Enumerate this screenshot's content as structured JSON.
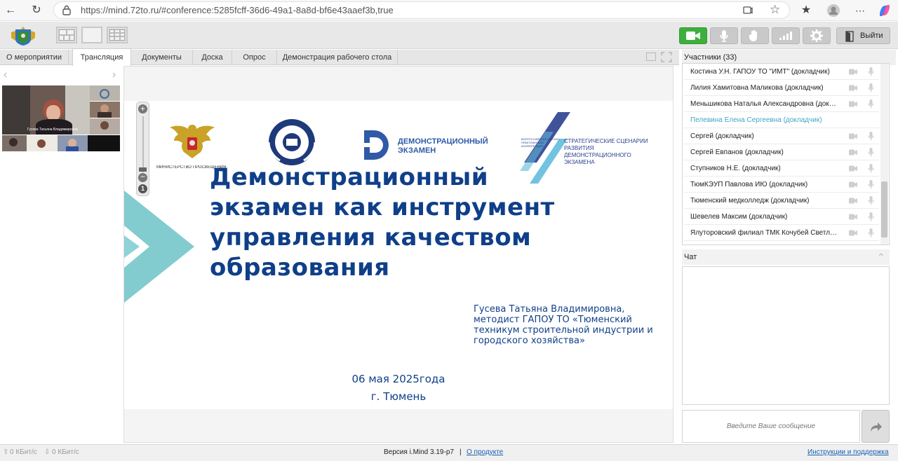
{
  "browser": {
    "url": "https://mind.72to.ru/#conference:5285fcff-36d6-49a1-8a8d-bf6e43aaef3b,true"
  },
  "toolbar": {
    "exit_label": "Выйти"
  },
  "tabs": [
    {
      "label": "О мероприятии"
    },
    {
      "label": "Трансляция"
    },
    {
      "label": "Документы"
    },
    {
      "label": "Доска"
    },
    {
      "label": "Опрос"
    },
    {
      "label": "Демонстрация рабочего стола"
    }
  ],
  "video": {
    "speaker_caption": "Гусева Татьяна Владимировна"
  },
  "slide": {
    "logos": {
      "ministry": "МИНИСТЕРСТВО ПРОСВЕЩЕНИЯ РОССИЙСКОЙ ФЕДЕРАЦИИ",
      "irpo": "ИРПО",
      "demo_exam": "ДЕМОНСТРАЦИОННЫЙ ЭКЗАМЕН",
      "conference_small": "ВСЕРОССИЙСКАЯ НАУЧНО-ПРАКТИЧЕСКАЯ КОНФЕРЕНЦИЯ",
      "conference_main": "СТРАТЕГИЧЕСКИЕ СЦЕНАРИИ РАЗВИТИЯ ДЕМОНСТРАЦИОННОГО ЭКЗАМЕНА"
    },
    "title_lines": [
      "Демонстрационный",
      "экзамен как инструмент",
      "управления качеством",
      "образования"
    ],
    "author_line1": "Гусева Татьяна Владимировна,",
    "author_line2": "методист ГАПОУ ТО «Тюменский",
    "author_line3": "техникум строительной индустрии и",
    "author_line4": "городского хозяйства»",
    "date": "06 мая 2025года",
    "city": "г. Тюмень"
  },
  "participants": {
    "header": "Участники (33)",
    "items": [
      {
        "name": "Костина У.Н. ГАПОУ ТО \"ИМТ\" (докладчик)",
        "highlighted": false
      },
      {
        "name": "Лилия Хамитовна Маликова (докладчик)",
        "highlighted": false
      },
      {
        "name": "Меньшикова Наталья Александровна (докладчик)",
        "highlighted": false
      },
      {
        "name": "Пелевина Елена Сергеевна (докладчик)",
        "highlighted": true
      },
      {
        "name": "Сергей (докладчик)",
        "highlighted": false
      },
      {
        "name": "Сергей Евпанов (докладчик)",
        "highlighted": false
      },
      {
        "name": "Ступников Н.Е. (докладчик)",
        "highlighted": false
      },
      {
        "name": "ТюмКЭУП Павлова ИЮ (докладчик)",
        "highlighted": false
      },
      {
        "name": "Тюменский медколледж (докладчик)",
        "highlighted": false
      },
      {
        "name": "Шевелев Максим (докладчик)",
        "highlighted": false
      },
      {
        "name": "Ялуторовский филиал ТМК Кочубей Светлана (докладчик)",
        "highlighted": false
      }
    ]
  },
  "chat": {
    "header": "Чат",
    "placeholder": "Введите Ваше сообщение"
  },
  "status": {
    "upload": "0 КБит/с",
    "download": "0 КБит/с",
    "version": "Версия i.Mind 3.19-p7",
    "separator": "|",
    "about_link": "О продукте",
    "help_link": "Инструкции и поддержка"
  },
  "colors": {
    "accent_green": "#3daf3d",
    "slide_blue": "#0f3f88",
    "teal": "#3bb0b8",
    "highlight_name": "#41a6c9"
  }
}
